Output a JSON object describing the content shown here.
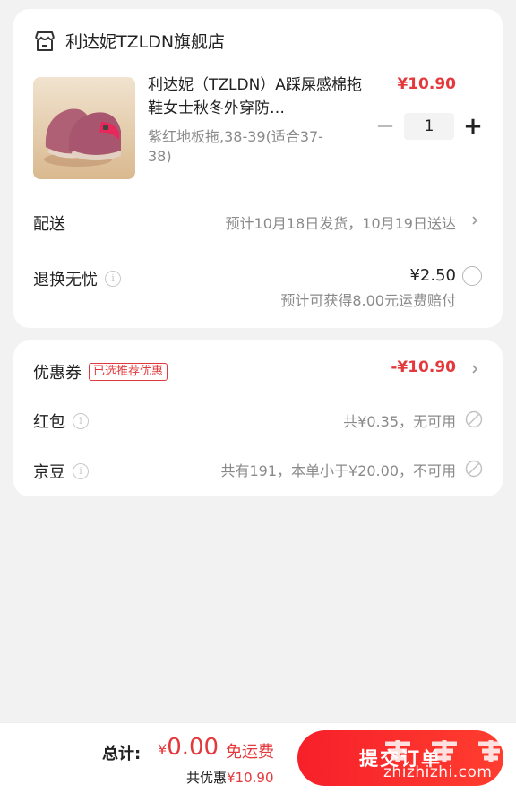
{
  "store": {
    "icon": "store-icon",
    "name": "利达妮TZLDN旗舰店"
  },
  "product": {
    "image": "slipper-product-image",
    "title": "利达妮（TZLDN）A踩屎感棉拖鞋女士秋冬外穿防…",
    "price": "¥10.90",
    "spec": "紫红地板拖,38-39(适合37-38)",
    "quantity": "1",
    "minus": "−",
    "plus": "+"
  },
  "shipping": {
    "label": "配送",
    "value": "预计10月18日发货，10月19日送达"
  },
  "return_service": {
    "label": "退换无忧",
    "price": "¥2.50",
    "note": "预计可获得8.00元运费赔付"
  },
  "coupon": {
    "label": "优惠券",
    "tag": "已选推荐优惠",
    "value": "-¥10.90"
  },
  "red_packet": {
    "label": "红包",
    "value": "共¥0.35，无可用"
  },
  "jd_beans": {
    "label": "京豆",
    "value": "共有191，本单小于¥20.00，不可用"
  },
  "footer": {
    "total_label": "总计:",
    "currency": "¥",
    "total_amount": "0.00",
    "free_shipping": "免运费",
    "saved_label": "共优惠",
    "saved_amount": "¥10.90",
    "submit_label": "提交订单",
    "watermark": "zhizhizhi.com"
  },
  "colors": {
    "accent": "#e4393c",
    "background": "#f2f2f2"
  }
}
